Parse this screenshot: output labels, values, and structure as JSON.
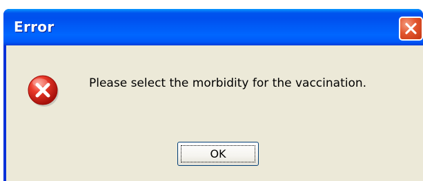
{
  "dialog": {
    "title": "Error",
    "message": "Please select the morbidity for the vaccination.",
    "ok_label": "OK",
    "icon": "error-icon",
    "close_icon": "close-icon"
  },
  "colors": {
    "titlebar": "#0054e3",
    "client_background": "#ece9d8",
    "close_button": "#e2552d",
    "error_icon": "#e0241c"
  }
}
